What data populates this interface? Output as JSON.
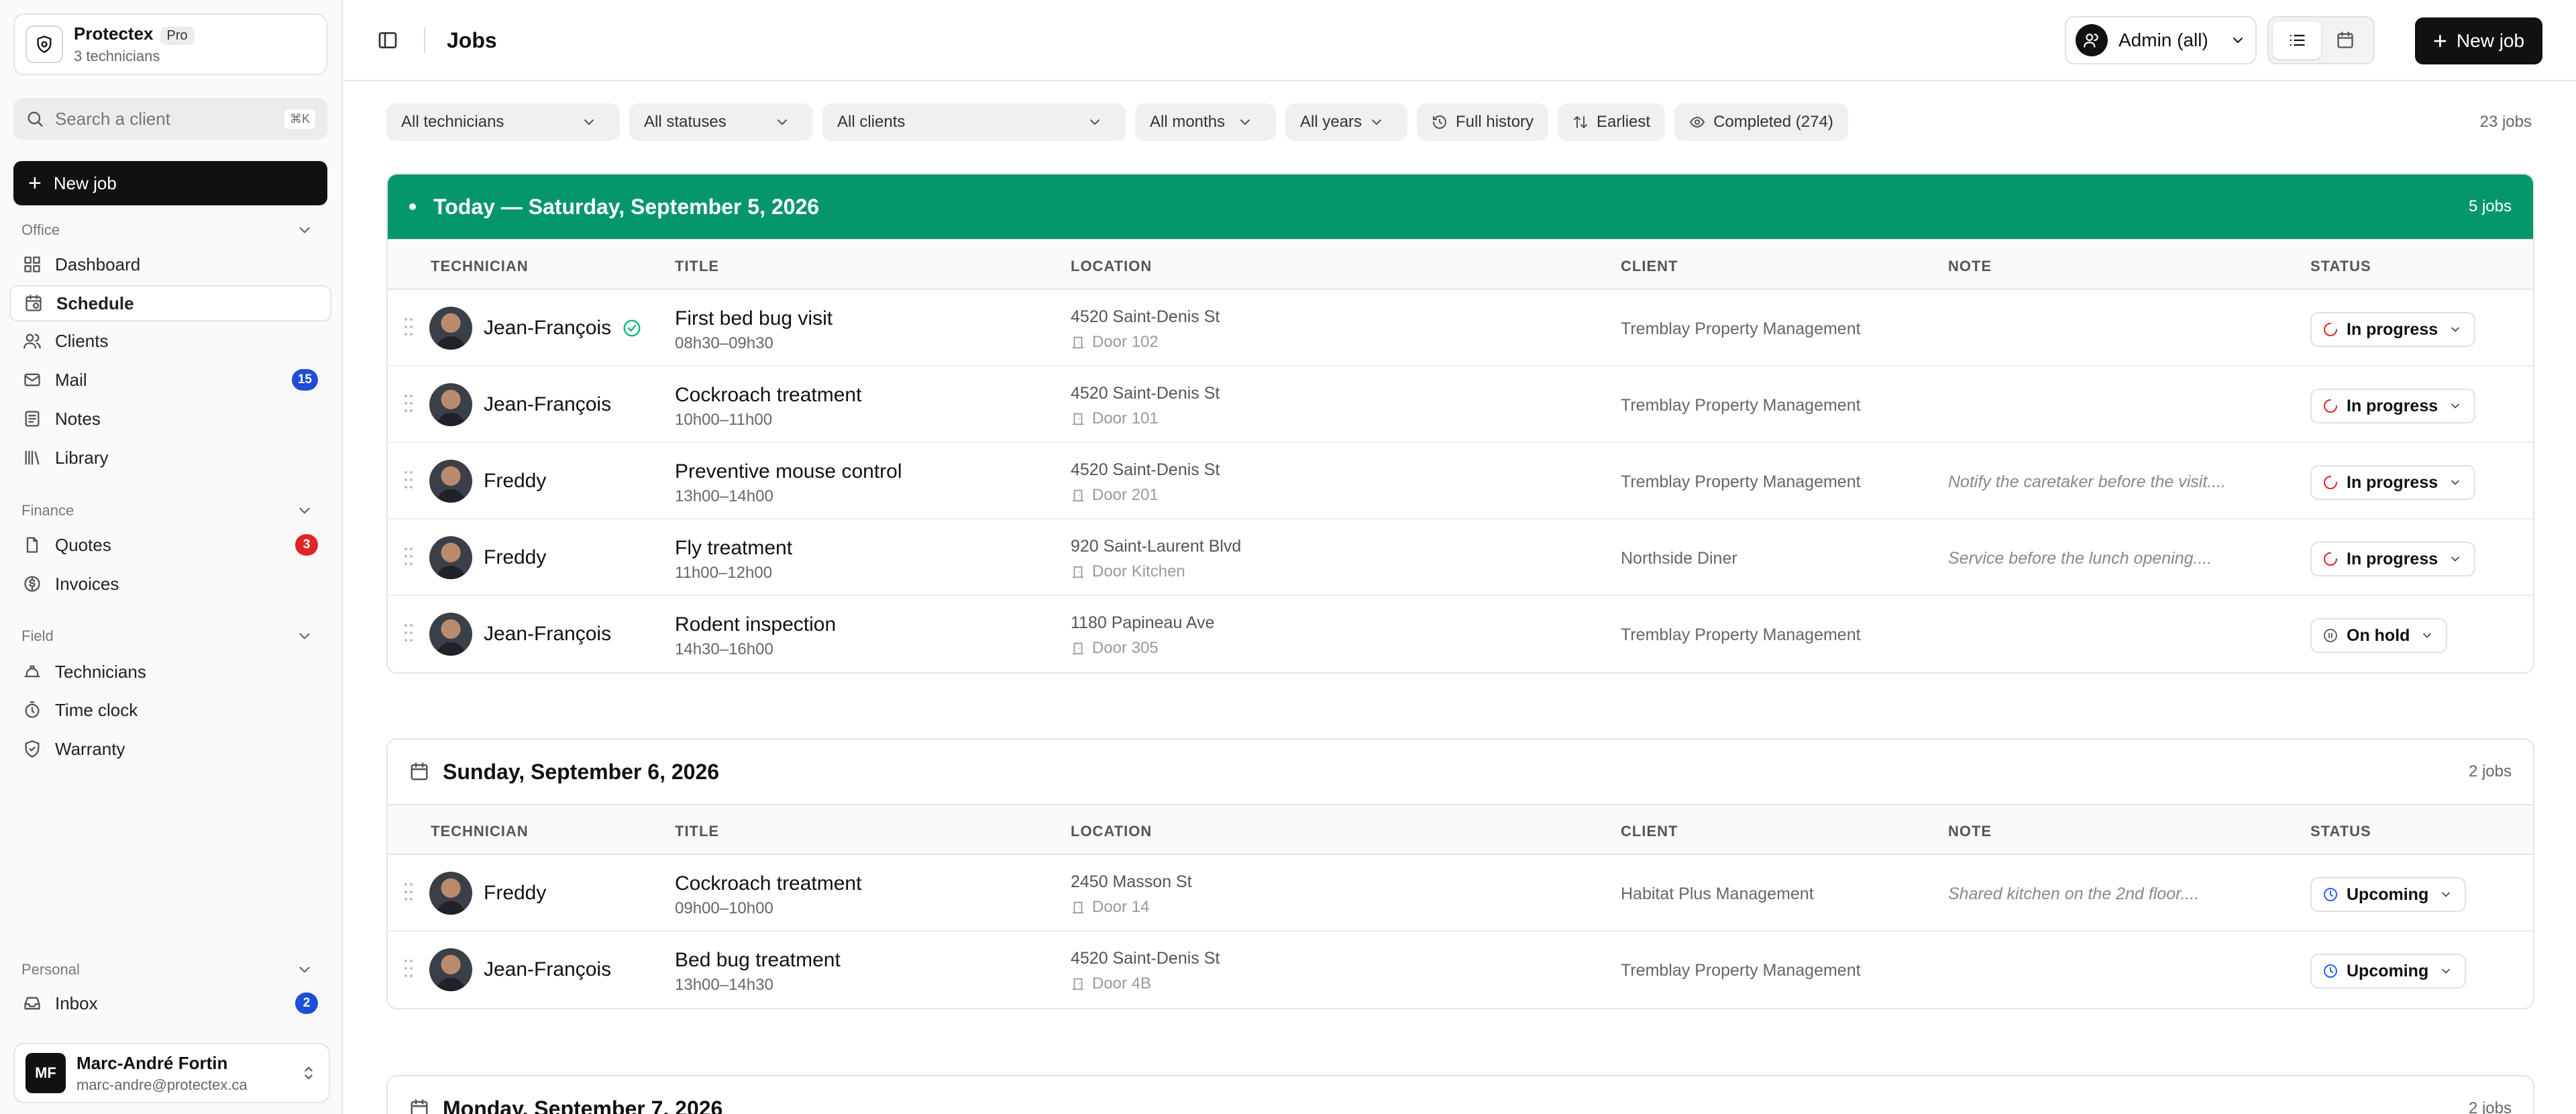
{
  "org": {
    "name": "Protectex",
    "badge": "Pro",
    "subtitle": "3 technicians"
  },
  "search": {
    "placeholder": "Search a client",
    "shortcut": "⌘K"
  },
  "sidebar_new_job": "New job",
  "sections": {
    "office": "Office",
    "finance": "Finance",
    "field": "Field",
    "personal": "Personal"
  },
  "nav": {
    "dashboard": "Dashboard",
    "schedule": "Schedule",
    "clients": "Clients",
    "mail": "Mail",
    "mail_badge": "15",
    "notes": "Notes",
    "library": "Library",
    "quotes": "Quotes",
    "quotes_badge": "3",
    "invoices": "Invoices",
    "technicians": "Technicians",
    "time_clock": "Time clock",
    "warranty": "Warranty",
    "inbox": "Inbox",
    "inbox_badge": "2"
  },
  "badge_colors": {
    "blue": "#1d4ed8",
    "red": "#dc2626"
  },
  "user": {
    "initials": "MF",
    "name": "Marc-André Fortin",
    "email": "marc-andre@protectex.ca"
  },
  "header": {
    "title": "Jobs",
    "admin_label": "Admin (all)",
    "new_job": "New job"
  },
  "filters": {
    "technicians": "All technicians",
    "statuses": "All statuses",
    "clients": "All clients",
    "months": "All months",
    "years": "All years",
    "history": "Full history",
    "sort": "Earliest",
    "completed": "Completed (274)",
    "total": "23 jobs"
  },
  "columns": {
    "technician": "TECHNICIAN",
    "title": "TITLE",
    "location": "LOCATION",
    "client": "CLIENT",
    "note": "NOTE",
    "status": "STATUS"
  },
  "accent_today": "#059669",
  "days": [
    {
      "label": "Today — Saturday, September 5, 2026",
      "count": "5 jobs",
      "rows": [
        {
          "technician": "Jean-François",
          "title": "First bed bug visit",
          "time": "08h30–09h30",
          "address": "4520 Saint-Denis St",
          "door": "Door 102",
          "client": "Tremblay Property Management",
          "note": "",
          "status": "In progress"
        },
        {
          "technician": "Jean-François",
          "title": "Cockroach treatment",
          "time": "10h00–11h00",
          "address": "4520 Saint-Denis St",
          "door": "Door 101",
          "client": "Tremblay Property Management",
          "note": "",
          "status": "In progress"
        },
        {
          "technician": "Freddy",
          "title": "Preventive mouse control",
          "time": "13h00–14h00",
          "address": "4520 Saint-Denis St",
          "door": "Door 201",
          "client": "Tremblay Property Management",
          "note": "Notify the caretaker before the visit....",
          "status": "In progress"
        },
        {
          "technician": "Freddy",
          "title": "Fly treatment",
          "time": "11h00–12h00",
          "address": "920 Saint-Laurent Blvd",
          "door": "Door Kitchen",
          "client": "Northside Diner",
          "note": "Service before the lunch opening....",
          "status": "In progress"
        },
        {
          "technician": "Jean-François",
          "title": "Rodent inspection",
          "time": "14h30–16h00",
          "address": "1180 Papineau Ave",
          "door": "Door 305",
          "client": "Tremblay Property Management",
          "note": "",
          "status": "On hold"
        }
      ]
    },
    {
      "label": "Sunday, September 6, 2026",
      "count": "2 jobs",
      "rows": [
        {
          "technician": "Freddy",
          "title": "Cockroach treatment",
          "time": "09h00–10h00",
          "address": "2450 Masson St",
          "door": "Door 14",
          "client": "Habitat Plus Management",
          "note": "Shared kitchen on the 2nd floor....",
          "status": "Upcoming"
        },
        {
          "technician": "Jean-François",
          "title": "Bed bug treatment",
          "time": "13h00–14h30",
          "address": "4520 Saint-Denis St",
          "door": "Door 4B",
          "client": "Tremblay Property Management",
          "note": "",
          "status": "Upcoming"
        }
      ]
    },
    {
      "label": "Monday, September 7, 2026",
      "count": "2 jobs"
    }
  ]
}
